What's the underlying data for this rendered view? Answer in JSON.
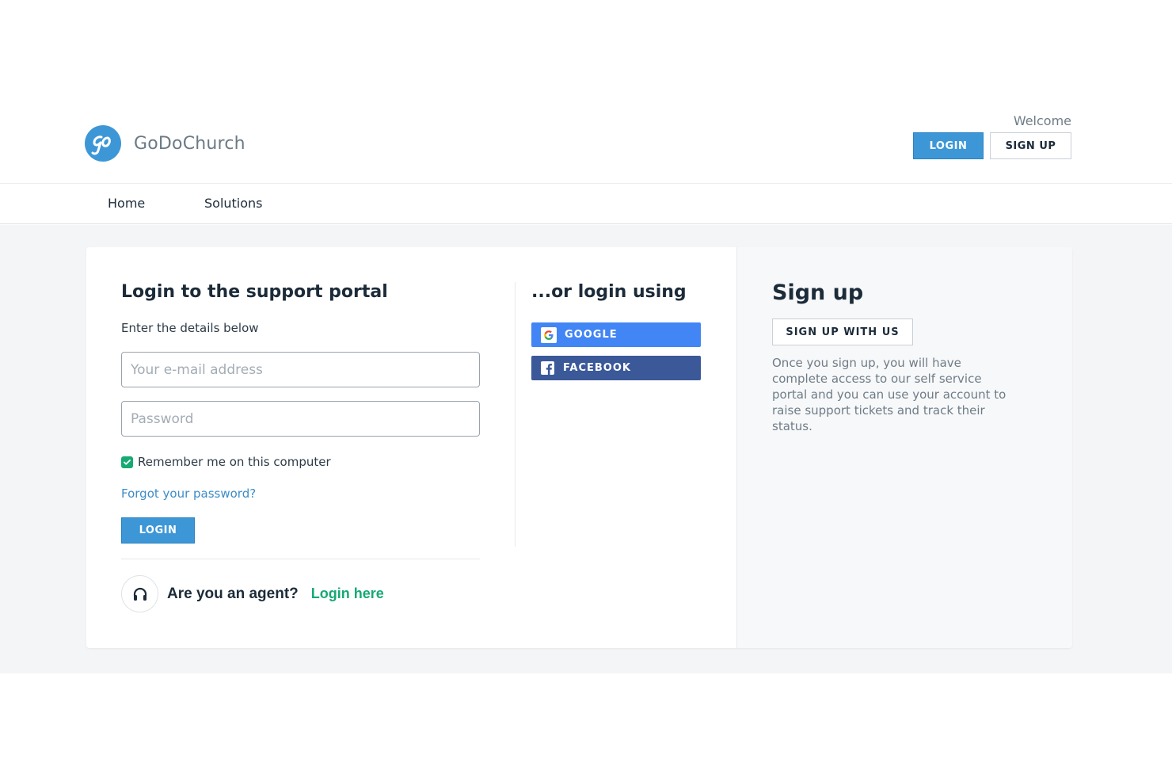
{
  "header": {
    "brand": "GoDoChurch",
    "logo_icon": "godochurch-logo-icon",
    "welcome": "Welcome",
    "login_label": "LOGIN",
    "signup_label": "SIGN UP"
  },
  "nav": {
    "items": [
      {
        "label": "Home"
      },
      {
        "label": "Solutions"
      }
    ]
  },
  "login": {
    "title": "Login to the support portal",
    "subtitle": "Enter the details below",
    "email_placeholder": "Your e-mail address",
    "email_value": "",
    "password_placeholder": "Password",
    "password_value": "",
    "remember_label": "Remember me on this computer",
    "remember_checked": true,
    "forgot_label": "Forgot your password?",
    "submit_label": "LOGIN"
  },
  "agent": {
    "question": "Are you an agent?",
    "link_label": "Login here",
    "icon": "headset-icon"
  },
  "social": {
    "title": "...or login using",
    "google_label": "GOOGLE",
    "facebook_label": "FACEBOOK"
  },
  "signup": {
    "title": "Sign up",
    "button_label": "SIGN UP WITH US",
    "description": "Once you sign up, you will have complete access to our self service portal and you can use your account to raise support tickets and track their status."
  },
  "colors": {
    "primary": "#3d97d6",
    "success": "#16a974",
    "google": "#4285f4",
    "facebook": "#3b5998",
    "link": "#3d8cc7"
  }
}
